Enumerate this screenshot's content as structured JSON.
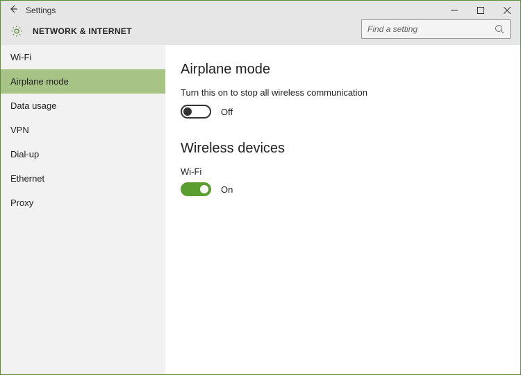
{
  "window": {
    "title": "Settings"
  },
  "header": {
    "section_title": "NETWORK & INTERNET",
    "search_placeholder": "Find a setting"
  },
  "sidebar": {
    "items": [
      {
        "label": "Wi-Fi",
        "selected": false
      },
      {
        "label": "Airplane mode",
        "selected": true
      },
      {
        "label": "Data usage",
        "selected": false
      },
      {
        "label": "VPN",
        "selected": false
      },
      {
        "label": "Dial-up",
        "selected": false
      },
      {
        "label": "Ethernet",
        "selected": false
      },
      {
        "label": "Proxy",
        "selected": false
      }
    ]
  },
  "main": {
    "heading": "Airplane mode",
    "description": "Turn this on to stop all wireless communication",
    "airplane_toggle": {
      "state": "off",
      "label": "Off"
    },
    "wireless_heading": "Wireless devices",
    "wifi_label": "Wi-Fi",
    "wifi_toggle": {
      "state": "on",
      "label": "On"
    }
  }
}
